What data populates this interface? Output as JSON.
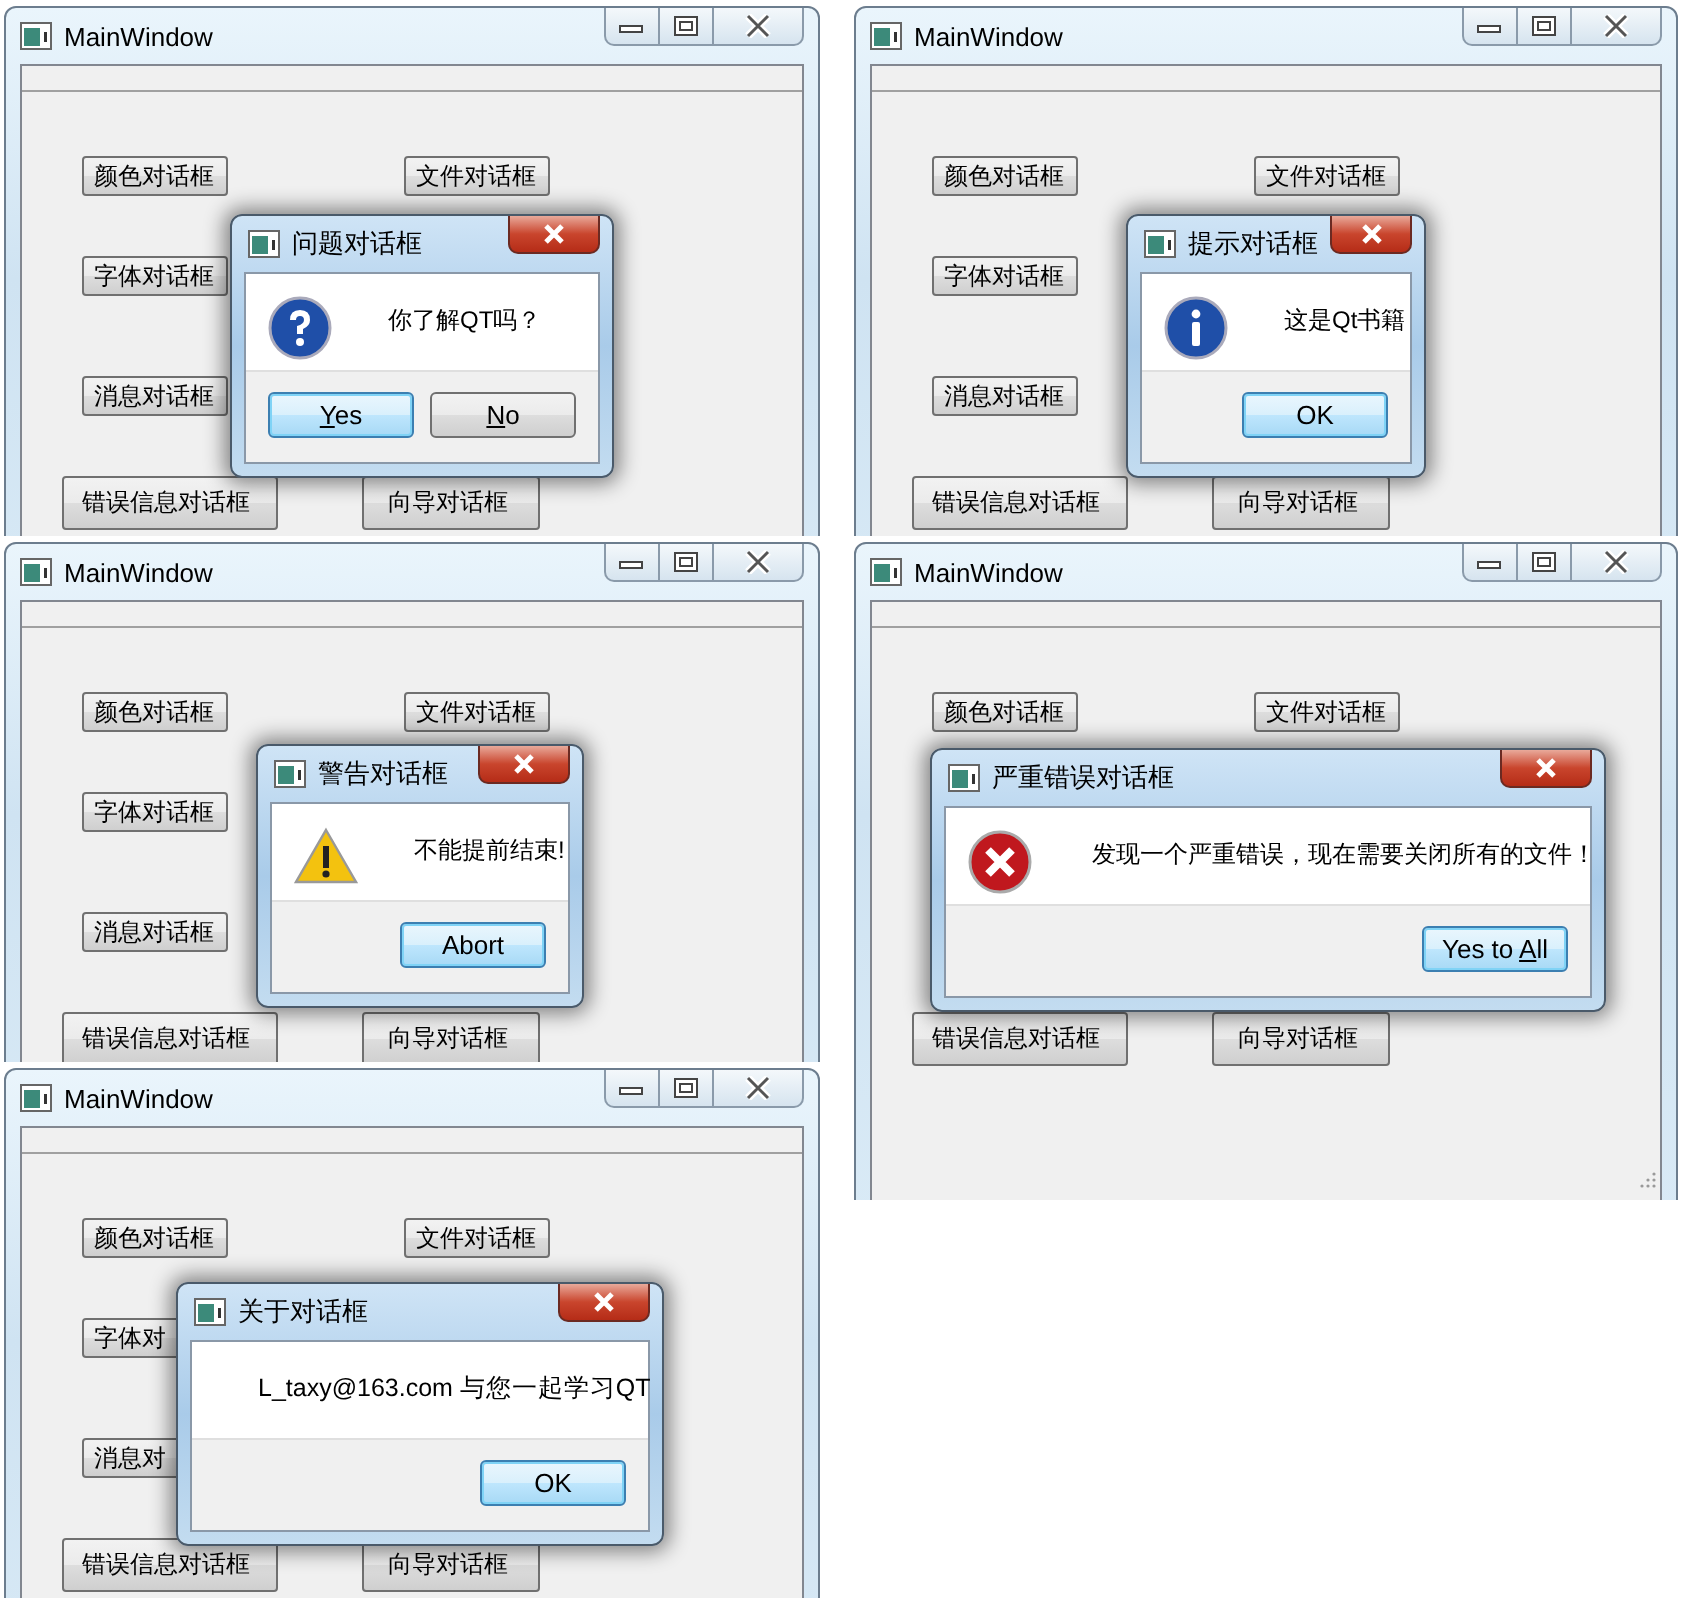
{
  "screens": [
    {
      "title": "MainWindow",
      "buttons": [
        {
          "kind": "r1c1",
          "label": "颜色对话框"
        },
        {
          "kind": "r1c2",
          "label": "文件对话框"
        },
        {
          "kind": "r2c1",
          "label": "字体对话框"
        },
        {
          "kind": "r3c1",
          "label": "消息对话框"
        },
        {
          "kind": "r4c1",
          "label": "错误信息对话框"
        },
        {
          "kind": "r4c2",
          "label": "向导对话框"
        }
      ],
      "dialog": {
        "kind": "question",
        "title": "问题对话框",
        "message": "你了解QT吗？",
        "buttons": [
          {
            "mnemonic": "Y",
            "after": "es",
            "default": true
          },
          {
            "mnemonic": "N",
            "after": "o",
            "default": false
          }
        ]
      }
    },
    {
      "title": "MainWindow",
      "buttons": [
        {
          "kind": "r1c1",
          "label": "颜色对话框"
        },
        {
          "kind": "r1c2",
          "label": "文件对话框"
        },
        {
          "kind": "r2c1",
          "label": "字体对话框"
        },
        {
          "kind": "r3c1",
          "label": "消息对话框"
        },
        {
          "kind": "r4c1",
          "label": "错误信息对话框"
        },
        {
          "kind": "r4c2",
          "label": "向导对话框"
        }
      ],
      "dialog": {
        "kind": "information",
        "title": "提示对话框",
        "message": "这是Qt书籍",
        "buttons": [
          {
            "before": "OK",
            "default": true
          }
        ]
      }
    },
    {
      "title": "MainWindow",
      "buttons": [
        {
          "kind": "r1c1",
          "label": "颜色对话框"
        },
        {
          "kind": "r1c2",
          "label": "文件对话框"
        },
        {
          "kind": "r2c1",
          "label": "字体对话框"
        },
        {
          "kind": "r3c1",
          "label": "消息对话框"
        },
        {
          "kind": "r4c1",
          "label": "错误信息对话框"
        },
        {
          "kind": "r4c2",
          "label": "向导对话框"
        }
      ],
      "dialog": {
        "kind": "warning",
        "title": "警告对话框",
        "message": "不能提前结束!",
        "buttons": [
          {
            "before": "Abort",
            "default": true
          }
        ]
      }
    },
    {
      "title": "MainWindow",
      "buttons": [
        {
          "kind": "r1c1",
          "label": "颜色对话框"
        },
        {
          "kind": "r1c2",
          "label": "文件对话框"
        },
        {
          "kind": "r4c1",
          "label": "错误信息对话框"
        },
        {
          "kind": "r4c2",
          "label": "向导对话框"
        }
      ],
      "dialog": {
        "kind": "critical",
        "title": "严重错误对话框",
        "message": "发现一个严重错误，现在需要关闭所有的文件！",
        "buttons": [
          {
            "before": "Yes to ",
            "mnemonic": "A",
            "after": "ll",
            "default": true
          }
        ]
      }
    },
    {
      "title": "MainWindow",
      "buttons": [
        {
          "kind": "r1c1",
          "label": "颜色对话框"
        },
        {
          "kind": "r1c2",
          "label": "文件对话框"
        },
        {
          "kind": "r2c1",
          "label": "字体对"
        },
        {
          "kind": "r3c1",
          "label": "消息对"
        },
        {
          "kind": "r4c1",
          "label": "错误信息对话框"
        },
        {
          "kind": "r4c2",
          "label": "向导对话框"
        }
      ],
      "dialog": {
        "kind": "about",
        "title": "关于对话框",
        "message": "L_taxy@163.com 与您一起学习QT",
        "buttons": [
          {
            "before": "OK",
            "default": true
          }
        ]
      }
    }
  ]
}
